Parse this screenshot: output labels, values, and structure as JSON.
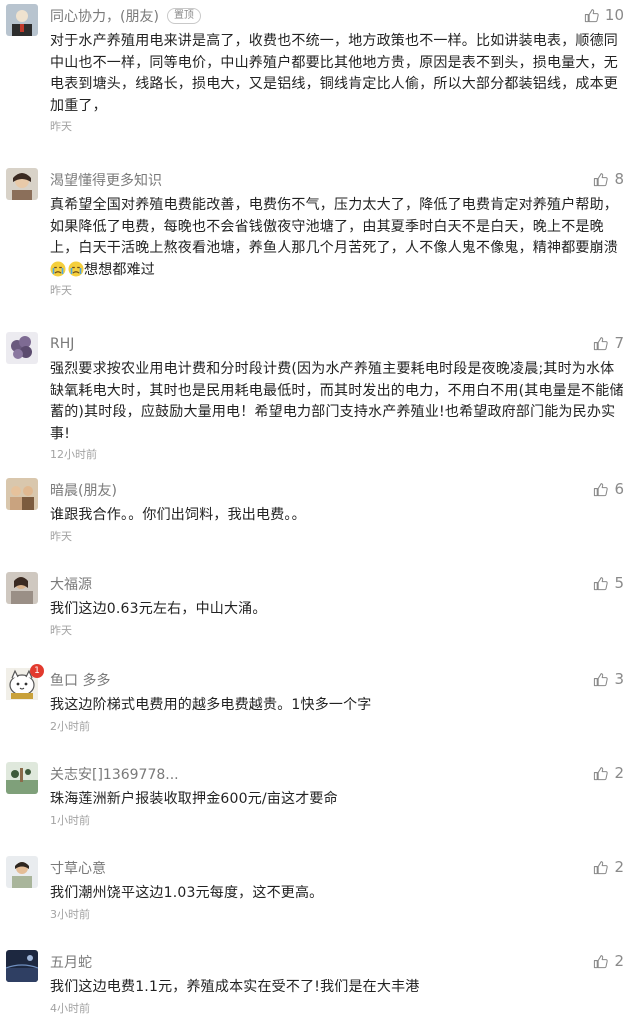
{
  "comments": [
    {
      "nickname": "同心协力，(朋友)",
      "badge": "置顶",
      "likes": "10",
      "text": "对于水产养殖用电来讲是高了，收费也不统一，地方政策也不一样。比如讲装电表，顺德同中山也不一样，同等电价，中山养殖户都要比其他地方贵，原因是表不到头，损电量大，无电表到塘头，线路长，损电大，又是铝线，铜线肯定比人偷，所以大部分都装铝线，成本更加重了，",
      "time": "昨天",
      "avatar_color": "#b8c4cf"
    },
    {
      "nickname": "渴望懂得更多知识",
      "likes": "8",
      "text": "真希望全国对养殖电费能改善，电费伤不气，压力太大了，降低了电费肯定对养殖户帮助，如果降低了电费，每晚也不会省钱傲夜守池塘了，由其夏季时白天不是白天，晚上不是晚上，白天干活晚上熬夜看池塘，养鱼人那几个月苦死了，人不像人鬼不像鬼，精神都要崩溃",
      "text_after_emoji": "想想都难过",
      "emoji": "crying-face",
      "time": "昨天",
      "avatar_color": "#8b6f5a"
    },
    {
      "nickname": "RHJ",
      "likes": "7",
      "text": "强烈要求按农业用电计费和分时段计费(因为水产养殖主要耗电时段是夜晚凌晨;其时为水体缺氧耗电大时，其时也是民用耗电最低时，而其时发出的电力，不用白不用(其电量是不能储蓄的)其时段，应鼓励大量用电！希望电力部门支持水产养殖业!也希望政府部门能为民办实事!",
      "time": "12小时前",
      "avatar_color": "#6a5a7e"
    },
    {
      "nickname": "暗晨(朋友)",
      "likes": "6",
      "text": "谁跟我合作。。你们出饲料，我出电费。。",
      "time": "昨天",
      "avatar_color": "#c9a37f"
    },
    {
      "nickname": "大福源",
      "likes": "5",
      "text": "我们这边0.63元左右，中山大涌。",
      "time": "昨天",
      "avatar_color": "#9a8f86"
    },
    {
      "nickname": "鱼口 多多",
      "likes": "3",
      "text": "我这边阶梯式电费用的越多电费越贵。1快多一个字",
      "time": "2小时前",
      "avatar_color": "#f1efe8",
      "avatar_badge": "1"
    },
    {
      "nickname": "关志安[]1369778...",
      "likes": "2",
      "text": "珠海莲洲新户报装收取押金600元/亩这才要命",
      "time": "1小时前",
      "avatar_color": "#7fa07a"
    },
    {
      "nickname": "寸草心意",
      "likes": "2",
      "text": "我们潮州饶平这边1.03元每度，这不更高。",
      "time": "3小时前",
      "avatar_color": "#a9b59b"
    },
    {
      "nickname": "五月蛇",
      "likes": "2",
      "text": "我们这边电费1.1元，养殖成本实在受不了!我们是在大丰港",
      "time": "4小时前",
      "avatar_color": "#2f3f63"
    }
  ],
  "icons": {
    "like": "thumbs-up-icon"
  }
}
